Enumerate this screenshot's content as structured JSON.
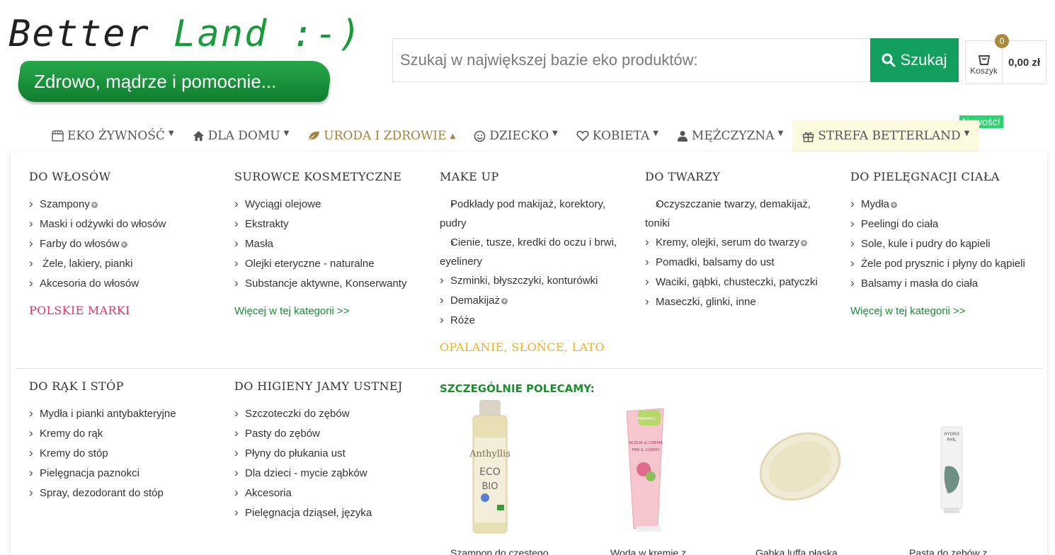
{
  "brand": {
    "name_part1": "Better",
    "name_part2": "Land :-)",
    "slogan": "Zdrowo, mądrze i pomocnie..."
  },
  "search": {
    "placeholder": "Szukaj w największej bazie eko produktów:",
    "button_label": "Szukaj"
  },
  "cart": {
    "count": "0",
    "label": "Koszyk",
    "total": "0,00 zł"
  },
  "nav": {
    "new_badge": "Nowość!",
    "items": [
      {
        "label": "EKO ŻYWNOŚĆ",
        "icon": "store-icon"
      },
      {
        "label": "DLA DOMU",
        "icon": "home-icon"
      },
      {
        "label": "URODA I ZDROWIE",
        "icon": "leaf-icon",
        "active": true
      },
      {
        "label": "DZIECKO",
        "icon": "smile-icon"
      },
      {
        "label": "KOBIETA",
        "icon": "heart-icon"
      },
      {
        "label": "MĘŻCZYZNA",
        "icon": "user-icon"
      },
      {
        "label": "STREFA BETTERLAND",
        "icon": "gift-icon"
      }
    ]
  },
  "menu": {
    "hair": {
      "title": "DO WŁOSÓW",
      "items": [
        "Szampony",
        "Maski i odżywki do włosów",
        "Farby do włosów",
        " Żele, lakiery, pianki",
        "Akcesoria do włosów"
      ],
      "brand_link": "POLSKIE MARKI"
    },
    "raw": {
      "title": "SUROWCE KOSMETYCZNE",
      "items": [
        "Wyciągi olejowe",
        "Ekstrakty",
        "Masła",
        "Olejki eteryczne - naturalne",
        "Substancje aktywne, Konserwanty"
      ],
      "more": "Więcej w tej kategorii >>"
    },
    "makeup": {
      "title": "MAKE UP",
      "items": [
        "Podkłady pod makijaż, korektory, pudry",
        "Cienie, tusze, kredki do oczu i brwi, eyelinery",
        "Szminki, błyszczyki, konturówki",
        "Demakijaż",
        "Róże"
      ],
      "special_link": "OPALANIE, SŁOŃCE, LATO"
    },
    "face": {
      "title": "DO TWARZY",
      "items": [
        "Oczyszczanie twarzy, demakijaż, toniki",
        "Kremy, olejki, serum do twarzy",
        "Pomadki, balsamy do ust",
        "Waciki, gąbki, chusteczki, patyczki",
        "Maseczki, glinki, inne"
      ]
    },
    "body": {
      "title": "DO PIELĘGNACJI CIAŁA",
      "items": [
        "Mydła",
        "Peelingi do ciała",
        "Sole, kule i pudry do kąpieli",
        "Żele pod prysznic i płyny do kąpieli",
        "Balsamy i masła do ciała"
      ],
      "more": "Więcej w tej kategorii >>"
    },
    "hands": {
      "title": "DO RĄK I STÓP",
      "items": [
        "Mydła i pianki antybakteryjne",
        "Kremy do rąk",
        "Kremy do stóp",
        "Pielęgnacja paznokci",
        "Spray, dezodorant do stóp"
      ]
    },
    "oral": {
      "title": "DO HIGIENY JAMY USTNEJ",
      "items": [
        "Szczoteczki do zębów",
        "Pasty do zębów",
        "Płyny do płukania ust",
        "Dla dzieci - mycie ząbków",
        "Akcesoria",
        "Pielęgnacja dziąseł, języka"
      ]
    }
  },
  "recommended": {
    "title": "SZCZEGÓLNIE POLECAMY:",
    "products": [
      {
        "name": "Szampon do częstego",
        "label_lines": [
          "Anthyllis",
          "ECO",
          "BIO"
        ]
      },
      {
        "name": "Woda w kremie z",
        "label_lines": [
          "PIERPAOLI",
          "ACQUA in CREMA",
          "PER IL CORPO"
        ]
      },
      {
        "name": "Gąbka luffa płaska"
      },
      {
        "name": "Pasta do zębów z",
        "label_lines": [
          "HYDRO",
          "PHIL"
        ]
      }
    ]
  },
  "colors": {
    "green": "#13a05e",
    "gold": "#a2833c",
    "pink": "#e0336e",
    "orange": "#f0b11c",
    "link_green": "#1c8b37"
  }
}
